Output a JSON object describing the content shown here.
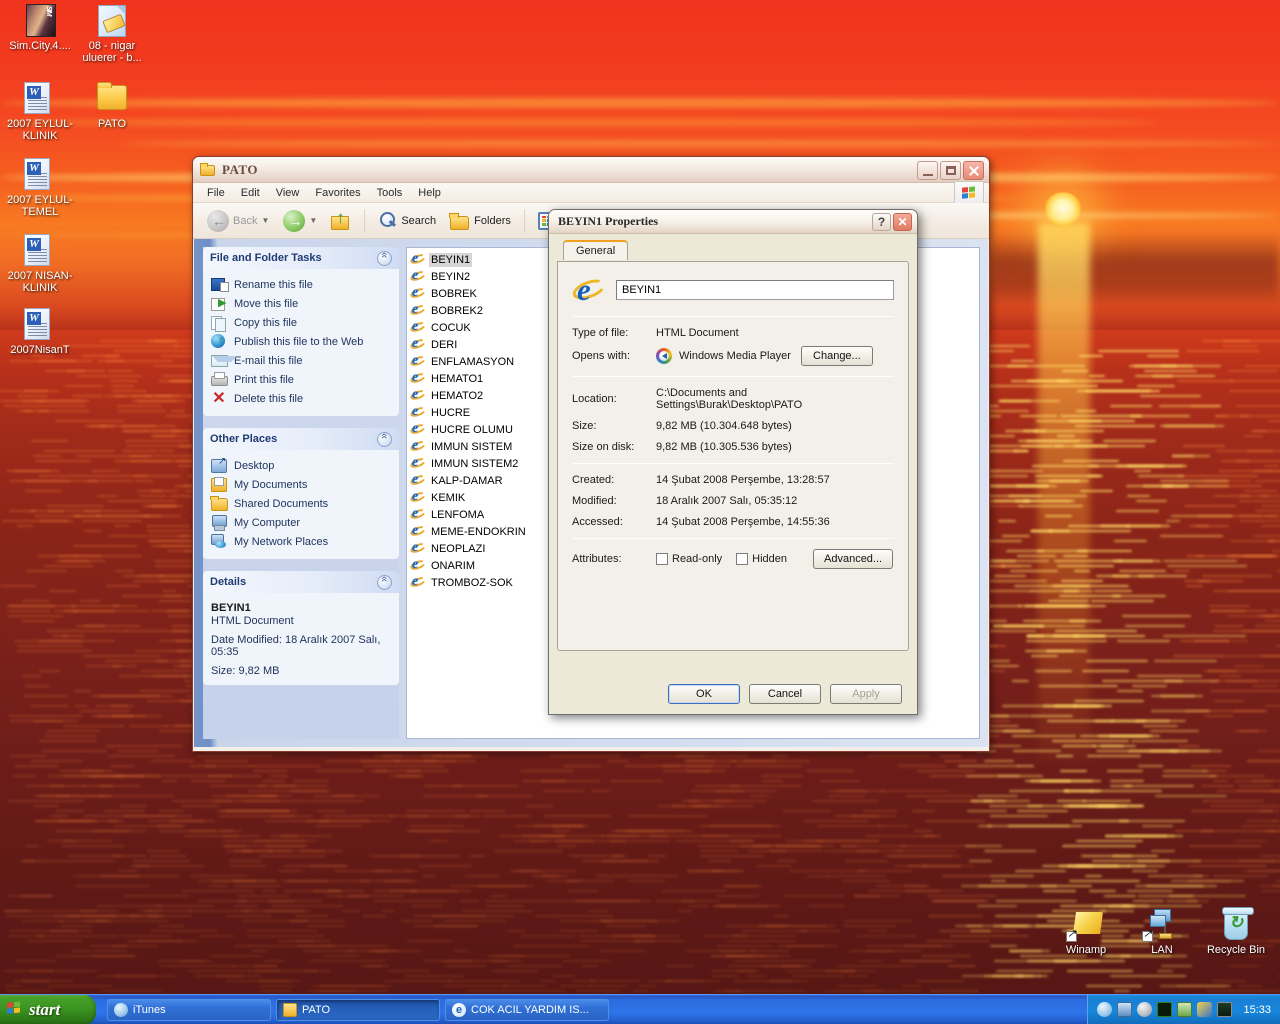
{
  "desktop": {
    "icons": [
      {
        "label": "Sim.City.4....",
        "type": "image-file"
      },
      {
        "label": "08 - nigar uluerer - b...",
        "type": "media-file"
      },
      {
        "label": "2007 EYLUL-KLINIK",
        "type": "word-document"
      },
      {
        "label": "PATO",
        "type": "folder"
      },
      {
        "label": "2007 EYLUL-TEMEL",
        "type": "word-document"
      },
      {
        "label": "2007 NISAN-KLINIK",
        "type": "word-document"
      },
      {
        "label": "2007NisanT",
        "type": "word-document"
      },
      {
        "label": "Winamp",
        "type": "application-shortcut"
      },
      {
        "label": "LAN",
        "type": "network-shortcut"
      },
      {
        "label": "Recycle Bin",
        "type": "recycle-bin"
      }
    ]
  },
  "explorer": {
    "title": "PATO",
    "menus": [
      "File",
      "Edit",
      "View",
      "Favorites",
      "Tools",
      "Help"
    ],
    "toolbar": {
      "back": "Back",
      "search": "Search",
      "folders": "Folders"
    },
    "window_buttons": {
      "minimize": "Minimize",
      "maximize": "Maximize",
      "close": "Close"
    },
    "sidebar": {
      "tasks_panel": {
        "title": "File and Folder Tasks",
        "items": [
          {
            "label": "Rename this file",
            "icon": "rename-icon"
          },
          {
            "label": "Move this file",
            "icon": "move-icon"
          },
          {
            "label": "Copy this file",
            "icon": "copy-icon"
          },
          {
            "label": "Publish this file to the Web",
            "icon": "globe-icon"
          },
          {
            "label": "E-mail this file",
            "icon": "mail-icon"
          },
          {
            "label": "Print this file",
            "icon": "printer-icon"
          },
          {
            "label": "Delete this file",
            "icon": "delete-x-icon"
          }
        ]
      },
      "places_panel": {
        "title": "Other Places",
        "items": [
          {
            "label": "Desktop",
            "icon": "desktop-icon"
          },
          {
            "label": "My Documents",
            "icon": "my-documents-icon"
          },
          {
            "label": "Shared Documents",
            "icon": "shared-documents-icon"
          },
          {
            "label": "My Computer",
            "icon": "my-computer-icon"
          },
          {
            "label": "My Network Places",
            "icon": "my-network-places-icon"
          }
        ]
      },
      "details_panel": {
        "title": "Details",
        "name": "BEYIN1",
        "type": "HTML Document",
        "date_modified": "Date Modified: 18 Aralık 2007 Salı, 05:35",
        "size": "Size: 9,82 MB"
      }
    },
    "files": [
      {
        "name": "BEYIN1",
        "selected": true
      },
      {
        "name": "BEYIN2",
        "selected": false
      },
      {
        "name": "BOBREK",
        "selected": false
      },
      {
        "name": "BOBREK2",
        "selected": false
      },
      {
        "name": "COCUK",
        "selected": false
      },
      {
        "name": "DERI",
        "selected": false
      },
      {
        "name": "ENFLAMASYON",
        "selected": false
      },
      {
        "name": "HEMATO1",
        "selected": false
      },
      {
        "name": "HEMATO2",
        "selected": false
      },
      {
        "name": "HUCRE",
        "selected": false
      },
      {
        "name": "HUCRE OLUMU",
        "selected": false
      },
      {
        "name": "IMMUN SISTEM",
        "selected": false
      },
      {
        "name": "IMMUN SISTEM2",
        "selected": false
      },
      {
        "name": "KALP-DAMAR",
        "selected": false
      },
      {
        "name": "KEMIK",
        "selected": false
      },
      {
        "name": "LENFOMA",
        "selected": false
      },
      {
        "name": "MEME-ENDOKRIN",
        "selected": false
      },
      {
        "name": "NEOPLAZI",
        "selected": false
      },
      {
        "name": "ONARIM",
        "selected": false
      },
      {
        "name": "TROMBOZ-SOK",
        "selected": false
      }
    ]
  },
  "properties_dialog": {
    "title": "BEYIN1 Properties",
    "help_button": "?",
    "close_button": "✕",
    "tabs": [
      {
        "label": "General",
        "active": true
      }
    ],
    "filename_value": "BEYIN1",
    "fields": {
      "type_label": "Type of file:",
      "type_value": "HTML Document",
      "opens_with_label": "Opens with:",
      "opens_with_value": "Windows Media Player",
      "change_button": "Change...",
      "location_label": "Location:",
      "location_value": "C:\\Documents and Settings\\Burak\\Desktop\\PATO",
      "size_label": "Size:",
      "size_value": "9,82 MB (10.304.648 bytes)",
      "size_on_disk_label": "Size on disk:",
      "size_on_disk_value": "9,82 MB (10.305.536 bytes)",
      "created_label": "Created:",
      "created_value": "14 Şubat 2008 Perşembe, 13:28:57",
      "modified_label": "Modified:",
      "modified_value": "18 Aralık 2007 Salı, 05:35:12",
      "accessed_label": "Accessed:",
      "accessed_value": "14 Şubat 2008 Perşembe, 14:55:36",
      "attributes_label": "Attributes:",
      "readonly_label": "Read-only",
      "readonly_checked": false,
      "hidden_label": "Hidden",
      "hidden_checked": false,
      "advanced_button": "Advanced..."
    },
    "buttons": {
      "ok": "OK",
      "cancel": "Cancel",
      "apply": "Apply"
    }
  },
  "taskbar": {
    "start_label": "start",
    "tasks": [
      {
        "label": "iTunes",
        "icon": "itunes-icon",
        "active": false
      },
      {
        "label": "PATO",
        "icon": "folder-icon",
        "active": true
      },
      {
        "label": "COK ACIL YARDIM IS...",
        "icon": "ie-icon",
        "active": false
      }
    ],
    "tray": {
      "icons": [
        "itunes-tray-icon",
        "network-tray-icon",
        "disc-tray-icon",
        "nvidia-tray-icon",
        "shield-tray-icon",
        "phone-tray-icon",
        "monitor-tray-icon"
      ],
      "clock": "15:33"
    }
  },
  "colors": {
    "desktop_sky": "#f2441f",
    "desktop_sea": "#8a2418",
    "taskbar_blue": "#2e74e8",
    "start_green": "#3c9422",
    "window_frame": "#a84434",
    "dialog_face": "#ece9d8",
    "selection_gray": "#d6d6d6"
  }
}
